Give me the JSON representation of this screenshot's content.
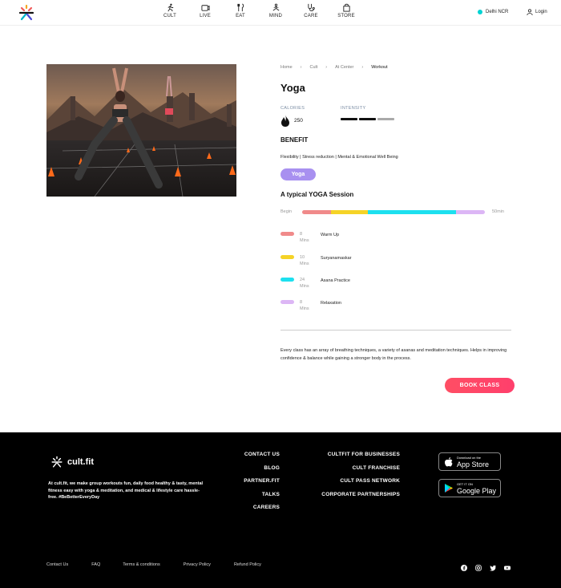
{
  "header": {
    "nav": [
      {
        "label": "CULT",
        "icon": "run-icon"
      },
      {
        "label": "LIVE",
        "icon": "live-icon"
      },
      {
        "label": "EAT",
        "icon": "eat-icon"
      },
      {
        "label": "MIND",
        "icon": "mind-icon"
      },
      {
        "label": "CARE",
        "icon": "stethoscope-icon"
      },
      {
        "label": "STORE",
        "icon": "bag-icon"
      }
    ],
    "location": "Delhi NCR",
    "login": "Login"
  },
  "breadcrumb": [
    "Home",
    "Cult",
    "At Center",
    "Workout"
  ],
  "workout": {
    "title": "Yoga",
    "calories_label": "CALORIES",
    "calories_value": "250",
    "intensity_label": "INTENSITY",
    "intensity_level": 2,
    "intensity_max": 3,
    "benefit_heading": "BENEFIT",
    "benefits": "Flexibility | Stress reduction | Mental & Emotional Well Being",
    "tag": "Yoga",
    "session_heading": "A typical YOGA Session",
    "scale_begin": "Begin",
    "scale_end": "50min",
    "segments": [
      {
        "minutes": "8",
        "unit": "Mins",
        "name": "Warm Up",
        "color": "#f08a8a",
        "value": 8
      },
      {
        "minutes": "10",
        "unit": "Mins",
        "name": "Suryanamaskar",
        "color": "#f5d327",
        "value": 10
      },
      {
        "minutes": "24",
        "unit": "Mins",
        "name": "Asana Practice",
        "color": "#1de0ef",
        "value": 24
      },
      {
        "minutes": "8",
        "unit": "Mins",
        "name": "Relaxation",
        "color": "#dcb6f5",
        "value": 8
      }
    ],
    "description": "Every class has an array of breathing techniques, a variety of asanas and meditation techniques. Helps in improving confidence & balance while gaining a stronger body in the process.",
    "book_label": "BOOK CLASS"
  },
  "colors": {
    "accent_purple": "#a890f0",
    "book_pink": "#ff4b67",
    "intensity_on": "#111111",
    "intensity_off": "#aaaaaa"
  },
  "footer": {
    "brand": "cult.fit",
    "about": "At cult.fit, we make group workouts fun, daily food healthy & tasty, mental fitness easy with yoga & meditation, and medical & lifestyle care hassle-free. #BeBetterEveryDay",
    "col1": [
      "CONTACT US",
      "BLOG",
      "PARTNER.FIT",
      "TALKS",
      "CAREERS"
    ],
    "col2": [
      "CULTFIT FOR BUSINESSES",
      "CULT FRANCHISE",
      "CULT PASS NETWORK",
      "CORPORATE PARTNERSHIPS"
    ],
    "appstore_small": "Download on the",
    "appstore_big": "App Store",
    "playstore_small": "GET IT ON",
    "playstore_big": "Google Play",
    "links": [
      "Contact Us",
      "FAQ",
      "Terms & conditions",
      "Privacy Policy",
      "Refund Policy"
    ],
    "socials": [
      "facebook-icon",
      "instagram-icon",
      "twitter-icon",
      "youtube-icon"
    ]
  }
}
